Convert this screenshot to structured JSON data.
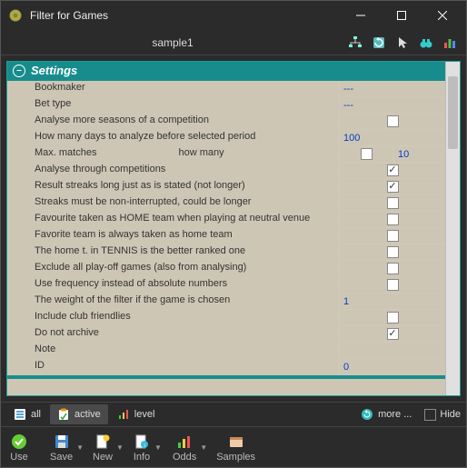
{
  "window": {
    "title": "Filter for Games"
  },
  "subheader": {
    "title": "sample1"
  },
  "settings": {
    "header": "Settings",
    "rows": [
      {
        "label": "Bookmaker",
        "type": "text",
        "value": "---"
      },
      {
        "label": "Bet type",
        "type": "text",
        "value": "---"
      },
      {
        "label": "Analyse more seasons of a competition",
        "type": "check",
        "checked": false
      },
      {
        "label": "How many days to analyze before selected period",
        "type": "text",
        "value": "100"
      },
      {
        "label": "Max. matches",
        "extraLabel": "how many",
        "type": "split",
        "checked": false,
        "value2": "10"
      },
      {
        "label": "Analyse through competitions",
        "type": "check",
        "checked": true
      },
      {
        "label": "Result streaks long just as is stated (not longer)",
        "type": "check",
        "checked": true
      },
      {
        "label": "Streaks must be non-interrupted, could be longer",
        "type": "check",
        "checked": false
      },
      {
        "label": "Favourite taken as HOME team when playing at neutral venue",
        "type": "check",
        "checked": false
      },
      {
        "label": "Favorite team is always taken as home team",
        "type": "check",
        "checked": false
      },
      {
        "label": "The home t. in TENNIS is the better ranked one",
        "type": "check",
        "checked": false
      },
      {
        "label": "Exclude all play-off games (also from analysing)",
        "type": "check",
        "checked": false
      },
      {
        "label": "Use frequency instead of absolute numbers",
        "type": "check",
        "checked": false
      },
      {
        "label": "The weight of the filter if the game is chosen",
        "type": "text",
        "value": "1"
      },
      {
        "label": "Include club friendlies",
        "type": "check",
        "checked": false
      },
      {
        "label": "Do not archive",
        "type": "check",
        "checked": true
      },
      {
        "label": "Note",
        "type": "text",
        "value": ""
      },
      {
        "label": "ID",
        "type": "text",
        "value": "0"
      }
    ]
  },
  "filterbar": {
    "all": "all",
    "active": "active",
    "level": "level",
    "more": "more ...",
    "hide": "Hide"
  },
  "toolbar": {
    "use": "Use",
    "save": "Save",
    "new": "New",
    "info": "Info",
    "odds": "Odds",
    "samples": "Samples"
  }
}
